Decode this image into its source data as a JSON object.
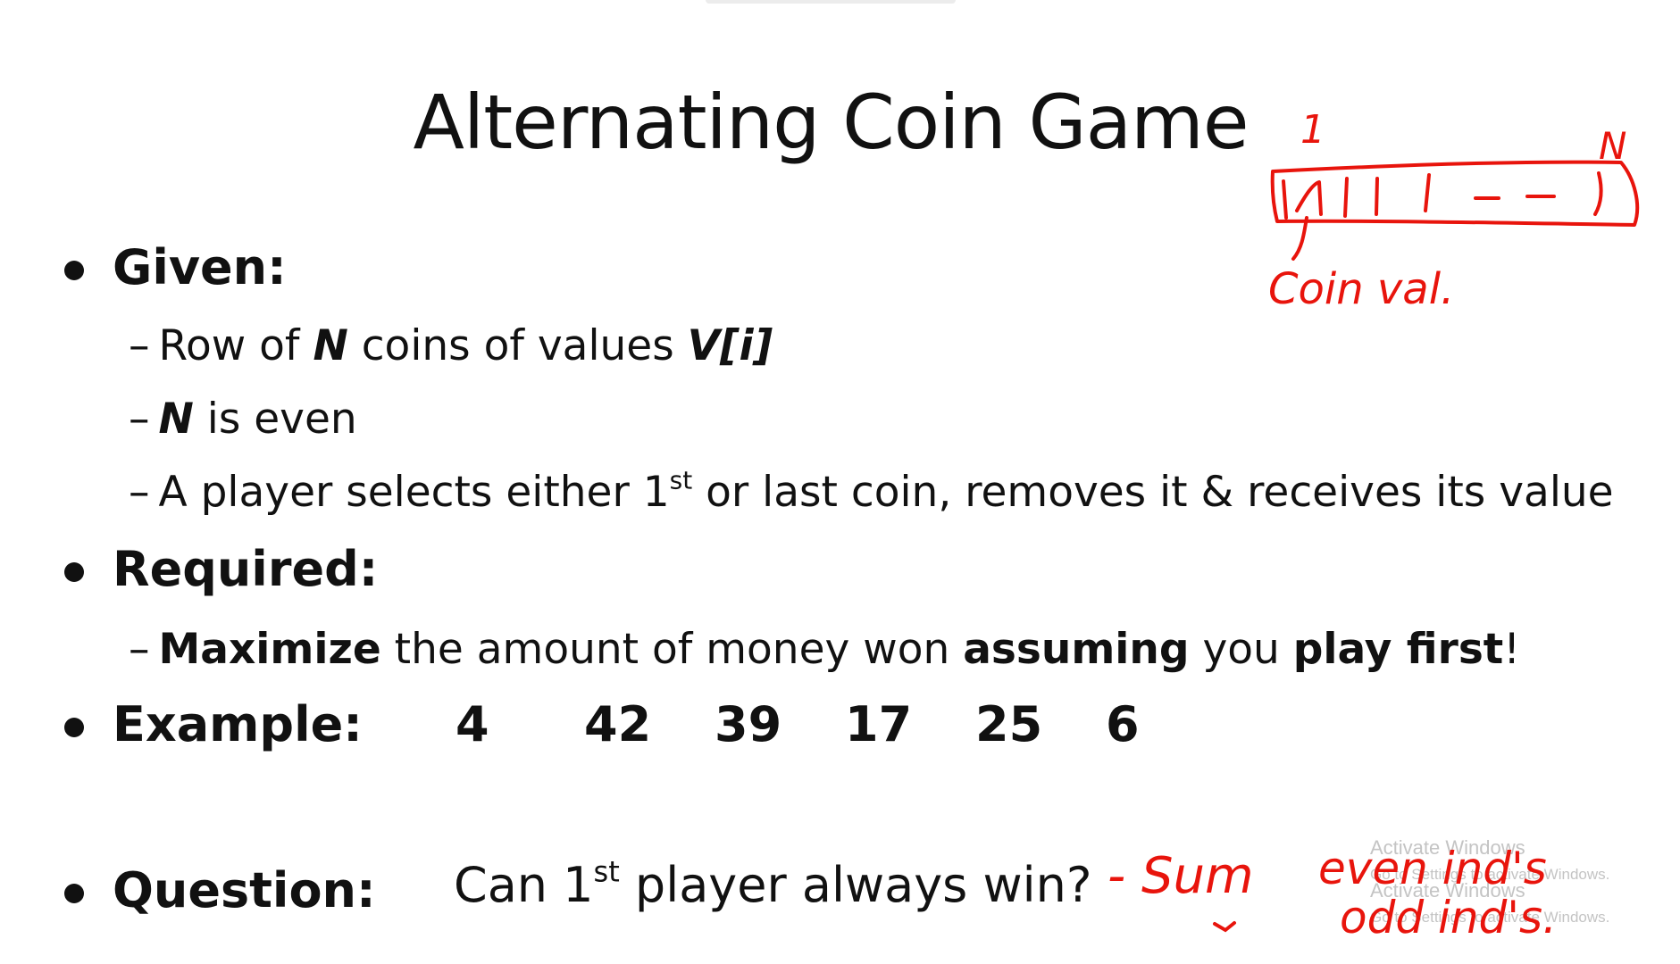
{
  "slide": {
    "title": "Alternating Coin Game",
    "given": {
      "label": "Given:",
      "item1": {
        "dash": "–",
        "a": "Row of ",
        "n": "N",
        "b": " coins of values ",
        "v": "V[i]"
      },
      "item2": {
        "dash": "–",
        "n": "N",
        "b": " is even"
      },
      "item3": {
        "dash": "–",
        "a": "A player selects either 1",
        "sup": "st",
        "b": " or last coin, removes it & receives its value"
      }
    },
    "required": {
      "label": "Required:",
      "item1": {
        "dash": "–",
        "a": "Maximize",
        "b": " the amount of money won ",
        "c": "assuming",
        "d": " you ",
        "e": "play first",
        "f": "!"
      }
    },
    "example": {
      "label": "Example:",
      "coins": [
        "4",
        "42",
        "39",
        "17",
        "25",
        "6"
      ]
    },
    "question": {
      "label": "Question:",
      "text_a": "Can 1",
      "sup": "st",
      "text_b": " player always win?"
    }
  },
  "annotations": {
    "ink_color": "#e8140c",
    "label_1": "1",
    "label_n": "N",
    "coin_val": "Coin val.",
    "sum": "- Sum",
    "even_inds": "even ind's",
    "odd_inds": "odd ind's."
  },
  "watermark": {
    "line1": "Activate Windows",
    "line2": "Go to Settings to activate Windows."
  }
}
